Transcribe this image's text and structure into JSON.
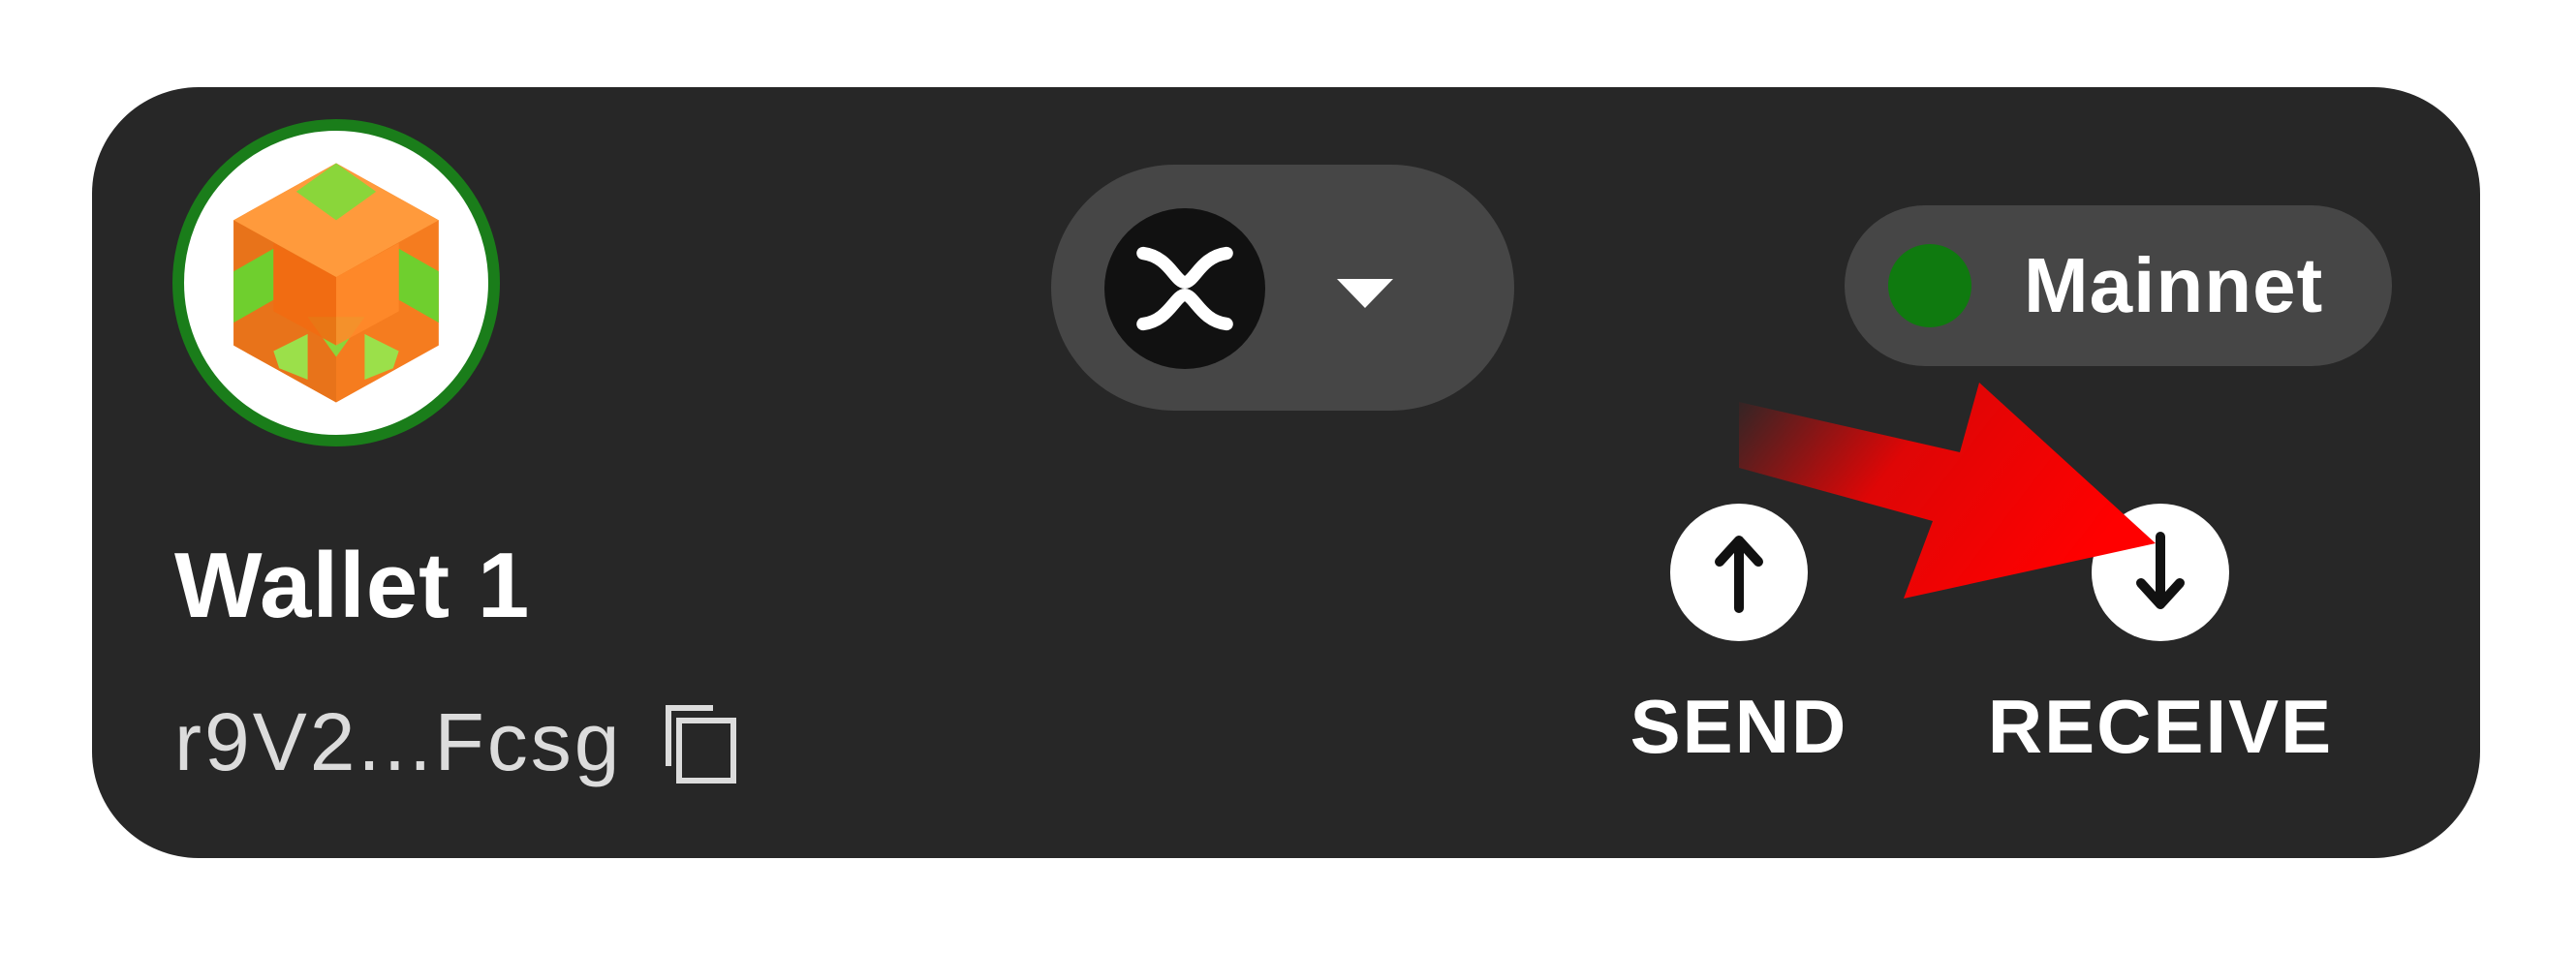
{
  "wallet": {
    "name": "Wallet 1",
    "address": "r9V2...Fcsg"
  },
  "token_selector": {
    "icon": "xrp-icon"
  },
  "network": {
    "label": "Mainnet",
    "status_color": "#0f7a0f"
  },
  "actions": {
    "send_label": "SEND",
    "receive_label": "RECEIVE"
  },
  "annotation": {
    "arrow_color": "#ff0000"
  },
  "colors": {
    "card_background": "#272727",
    "pill_background": "#464646",
    "avatar_ring": "#1a7d1a"
  }
}
